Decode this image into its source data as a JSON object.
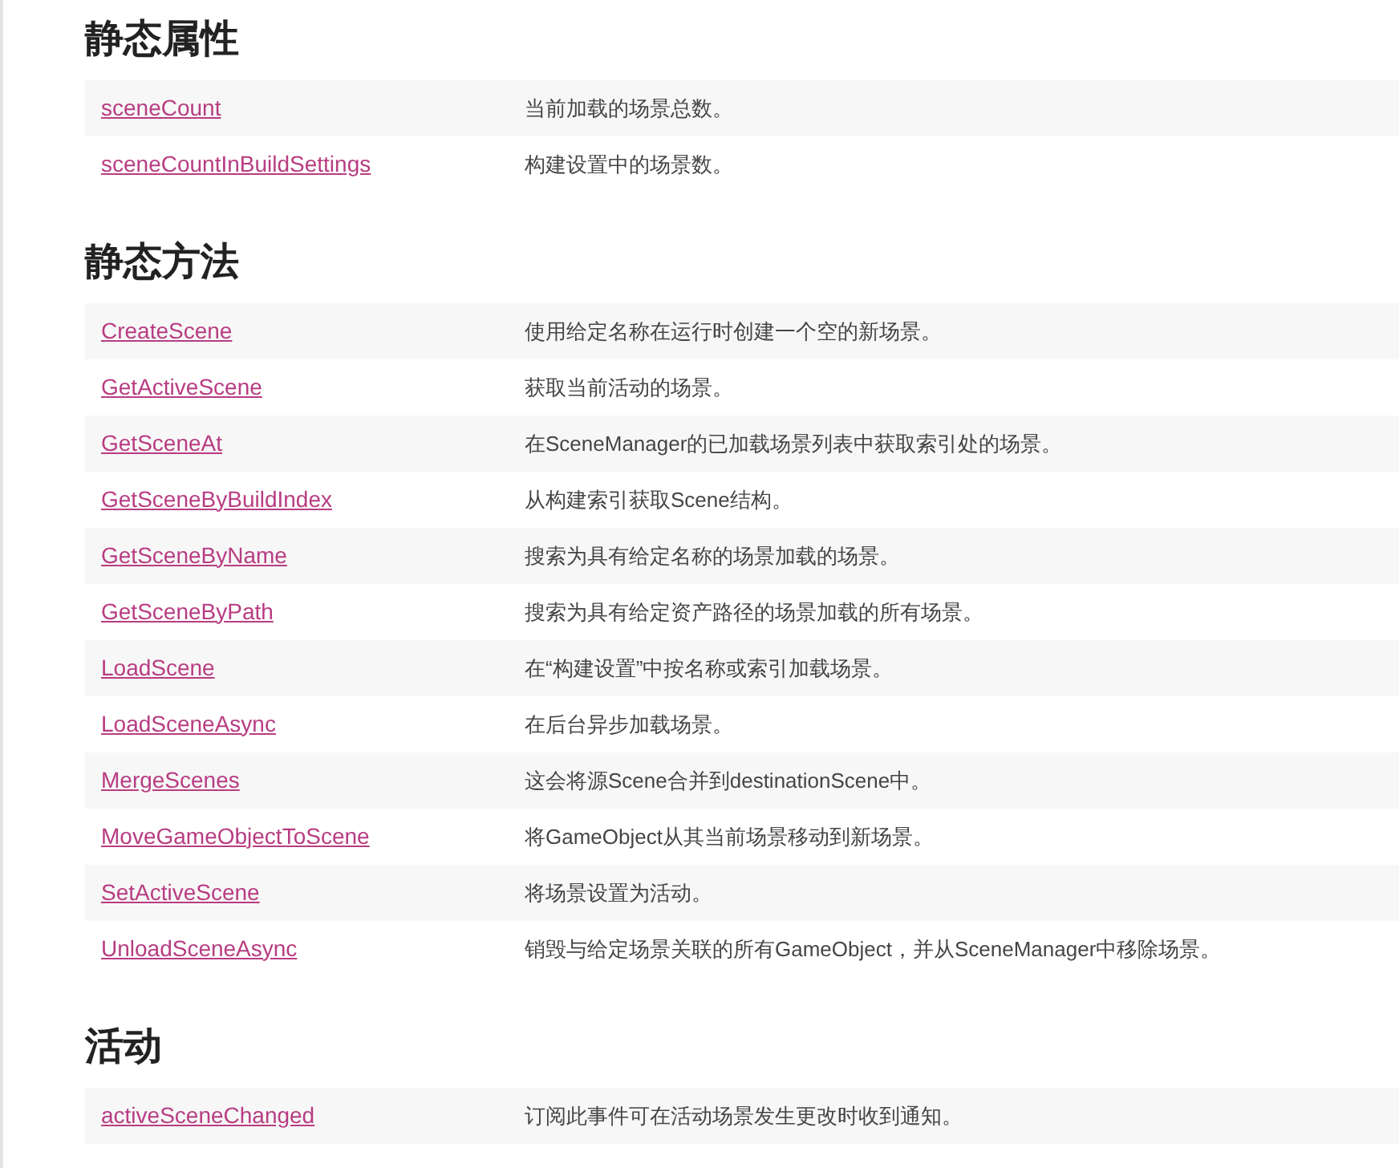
{
  "sections": [
    {
      "title": "静态属性",
      "rows": [
        {
          "name": "sceneCount",
          "description": "当前加载的场景总数。"
        },
        {
          "name": "sceneCountInBuildSettings",
          "description": "构建设置中的场景数。"
        }
      ]
    },
    {
      "title": "静态方法",
      "rows": [
        {
          "name": "CreateScene",
          "description": "使用给定名称在运行时创建一个空的新场景。"
        },
        {
          "name": "GetActiveScene",
          "description": "获取当前活动的场景。"
        },
        {
          "name": "GetSceneAt",
          "description": "在SceneManager的已加载场景列表中获取索引处的场景。"
        },
        {
          "name": "GetSceneByBuildIndex",
          "description": "从构建索引获取Scene结构。"
        },
        {
          "name": "GetSceneByName",
          "description": "搜索为具有给定名称的场景加载的场景。"
        },
        {
          "name": "GetSceneByPath",
          "description": "搜索为具有给定资产路径的场景加载的所有场景。"
        },
        {
          "name": "LoadScene",
          "description": "在“构建设置”中按名称或索引加载场景。"
        },
        {
          "name": "LoadSceneAsync",
          "description": "在后台异步加载场景。"
        },
        {
          "name": "MergeScenes",
          "description": "这会将源Scene合并到destinationScene中。"
        },
        {
          "name": "MoveGameObjectToScene",
          "description": "将GameObject从其当前场景移动到新场景。"
        },
        {
          "name": "SetActiveScene",
          "description": "将场景设置为活动。"
        },
        {
          "name": "UnloadSceneAsync",
          "description": "销毁与给定场景关联的所有GameObject，并从SceneManager中移除场景。"
        }
      ]
    },
    {
      "title": "活动",
      "rows": [
        {
          "name": "activeSceneChanged",
          "description": "订阅此事件可在活动场景发生更改时收到通知。"
        }
      ]
    }
  ]
}
